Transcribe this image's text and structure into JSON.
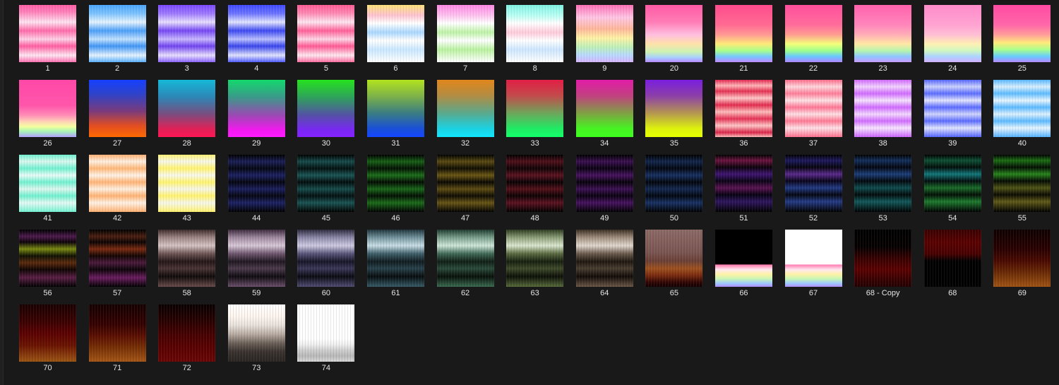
{
  "window": {
    "items": [
      {
        "label": "1",
        "bg": "linear-gradient(180deg,#ff5fa5 0%,#ff7fb8 12%,#ffe3f0 30%,#ff6aa9 45%,#ffd0e6 60%,#ff5da0 72%,#ffe6f2 88%,#ff6fb0 100%)",
        "tex": "wave"
      },
      {
        "label": "2",
        "bg": "linear-gradient(180deg,#4aa7ff 0%,#7cc3ff 15%,#e5f3ff 30%,#4a9ef8 45%,#bfe0ff 60%,#3f95f5 72%,#e3f2ff 88%,#57afff 100%)",
        "tex": "wave"
      },
      {
        "label": "3",
        "bg": "linear-gradient(180deg,#7a48ff 0%,#9d78ff 15%,#e7deff 30%,#7446f4 45%,#c7b6ff 60%,#6f42ef 72%,#e6ddff 88%,#8a60ff 100%)",
        "tex": "wave"
      },
      {
        "label": "4",
        "bg": "linear-gradient(180deg,#3f49ff 0%,#6a73ff 15%,#e2e5ff 30%,#3a47f0 45%,#b9bfff 60%,#3643ea 72%,#e0e3ff 88%,#4d59ff 100%)",
        "tex": "wave"
      },
      {
        "label": "5",
        "bg": "linear-gradient(180deg,#ff5a95 0%,#ff86b2 14%,#ffe5ef 30%,#ff5f98 45%,#ffd4e5 60%,#ff5a93 72%,#ffe6ef 88%,#ff6b9f 100%)",
        "tex": "wave"
      },
      {
        "label": "6",
        "bg": "linear-gradient(180deg,#ffe27a 0%,#ffc2cf 18%,#ffffff 32%,#a9d7ff 48%,#ffffff 62%,#c9e7ff 78%,#ffffff 100%)",
        "tex": "wave"
      },
      {
        "label": "7",
        "bg": "linear-gradient(180deg,#ff88e4 0%,#ffc1ef 18%,#ffffff 32%,#bdf3a6 48%,#ffffff 62%,#b9f29f 78%,#ffffff 100%)",
        "tex": "wave"
      },
      {
        "label": "8",
        "bg": "linear-gradient(180deg,#7ef2e2 0%,#b8fff4 18%,#ffffff 32%,#ffcadb 48%,#ffffff 62%,#cde6ff 78%,#ffffff 100%)",
        "tex": "wave"
      },
      {
        "label": "9",
        "bg": "linear-gradient(180deg,#ff6fb6 0%,#ffc6e5 22%,#ffb79a 42%,#fff2a5 58%,#bdf0b9 74%,#b8d8ff 88%,#d6b4ff 100%)",
        "tex": "wave"
      },
      {
        "label": "20",
        "bg": "linear-gradient(180deg,#ff5aa5 0%,#ff7db6 30%,#ffbfe0 52%,#ffe1a9 68%,#ccf2b3 82%,#a8cfff 92%,#b888ff 100%)",
        "tex": ""
      },
      {
        "label": "21",
        "bg": "linear-gradient(180deg,#ff4b8d 0%,#ff6b93 35%,#ff9a95 52%,#ffe978 68%,#a8ff8a 80%,#75c8ff 90%,#c089ff 100%)",
        "tex": ""
      },
      {
        "label": "22",
        "bg": "linear-gradient(180deg,#ff4f9c 0%,#ff6d9b 35%,#ff9e92 52%,#f4ff7a 68%,#9dff8c 80%,#68c7ff 90%,#b286ff 100%)",
        "tex": ""
      },
      {
        "label": "23",
        "bg": "linear-gradient(180deg,#ff62ac 0%,#ff86bb 35%,#ffaeb8 52%,#ffe7a4 68%,#b5f5ad 80%,#8fc6ff 90%,#c99cff 100%)",
        "tex": ""
      },
      {
        "label": "24",
        "bg": "linear-gradient(180deg,#ff8bca 0%,#ffa4d2 35%,#ffbfd4 52%,#fff0b3 68%,#cff7c0 80%,#acd4ff 90%,#d2b0ff 100%)",
        "tex": ""
      },
      {
        "label": "25",
        "bg": "linear-gradient(180deg,#ff4aa2 0%,#ff67a9 35%,#ff9d9a 52%,#ffe97b 66%,#a9ff8b 78%,#68cbff 90%,#b689ff 100%)",
        "tex": ""
      },
      {
        "label": "26",
        "bg": "linear-gradient(180deg,#ff48a8 0%,#ff56aa 45%,#ff8db7 62%,#ffd8b5 74%,#f3ff9f 82%,#a7f5b6 90%,#b4a0ff 100%)",
        "tex": ""
      },
      {
        "label": "27",
        "bg": "linear-gradient(180deg,#1640ff 0%,#2f43c8 25%,#7b3b7a 55%,#e14e22 80%,#ff6a00 100%)",
        "tex": ""
      },
      {
        "label": "28",
        "bg": "linear-gradient(180deg,#16b9d8 0%,#2c86b6 30%,#7a4d7f 60%,#de2257 85%,#ff1555 100%)",
        "tex": ""
      },
      {
        "label": "29",
        "bg": "linear-gradient(180deg,#13d86c 0%,#3a9a89 30%,#9b49b3 62%,#f319ef 88%,#ff1cff 100%)",
        "tex": ""
      },
      {
        "label": "30",
        "bg": "linear-gradient(180deg,#26e21e 0%,#2ea35a 30%,#5550a6 62%,#7a27f5 88%,#8622ff 100%)",
        "tex": ""
      },
      {
        "label": "31",
        "bg": "linear-gradient(180deg,#b2e31e 0%,#7fb348 28%,#3b7d82 58%,#1a50d6 85%,#1446ff 100%)",
        "tex": ""
      },
      {
        "label": "32",
        "bg": "linear-gradient(180deg,#e1871b 0%,#b18c44 28%,#5aa98d 58%,#1cd1e1 85%,#12e7ff 100%)",
        "tex": ""
      },
      {
        "label": "33",
        "bg": "linear-gradient(180deg,#e21f46 0%,#c24b4b 28%,#6fa55b 58%,#20ea63 85%,#14ff6a 100%)",
        "tex": ""
      },
      {
        "label": "34",
        "bg": "linear-gradient(180deg,#e21ca8 0%,#c0417f 28%,#80a044 58%,#47f222 85%,#3cff1f 100%)",
        "tex": ""
      },
      {
        "label": "35",
        "bg": "linear-gradient(180deg,#7a1fe0 0%,#8c3fa8 28%,#b49650 58%,#dcf10e 85%,#e6ff00 100%)",
        "tex": ""
      },
      {
        "label": "36",
        "bg": "linear-gradient(180deg,#e2254e 0%,#ffb4b7 10%,#e43152 20%,#ffc6c7 32%,#e12a4d 44%,#ffbcbc 56%,#e43254 68%,#ffc5c5 80%,#d92448 92%,#ffbdbd 100%)",
        "tex": "wave"
      },
      {
        "label": "37",
        "bg": "linear-gradient(180deg,#ff6a8a 0%,#ffd7dd 12%,#ff7d98 24%,#ffe3e6 36%,#ff7594 48%,#ffdfe4 60%,#ff7893 72%,#ffe0e6 84%,#ff6f8c 100%)",
        "tex": "wave"
      },
      {
        "label": "38",
        "bg": "linear-gradient(180deg,#d168ff 0%,#f2d2ff 12%,#d06bff 24%,#f6e3ff 36%,#cf69ff 48%,#f2d7ff 60%,#d06cff 72%,#f6e3ff 84%,#cc63ff 100%)",
        "tex": "wave"
      },
      {
        "label": "39",
        "bg": "linear-gradient(180deg,#5566ff 0%,#cbd1ff 12%,#5a6bff 24%,#e3e6ff 36%,#5969ff 48%,#cfd4ff 60%,#5a6aff 72%,#e0e4ff 84%,#5262ff 100%)",
        "tex": "wave"
      },
      {
        "label": "40",
        "bg": "linear-gradient(180deg,#56b7ff 0%,#d7efff 12%,#5cbbff 24%,#e7f6ff 36%,#5ab9ff 48%,#dcf0ff 60%,#5bb9ff 72%,#e5f5ff 84%,#53b2ff 100%)",
        "tex": "wave"
      },
      {
        "label": "41",
        "bg": "linear-gradient(180deg,#6ff1d0 0%,#d9f8ef 12%,#6ff0cf 24%,#e7fbf6 36%,#6ff0cf 48%,#dcf7ef 60%,#6ef0ce 72%,#e4f9f4 84%,#73f2d2 100%)",
        "tex": "wave"
      },
      {
        "label": "42",
        "bg": "linear-gradient(180deg,#ffb071 0%,#fff0e1 12%,#ffb677 24%,#fff2e6 36%,#ffb374 48%,#ffefdf 60%,#ffb272 72%,#fff1e4 84%,#ffb06f 100%)",
        "tex": "wave"
      },
      {
        "label": "43",
        "bg": "linear-gradient(180deg,#fff271 0%,#f7f7e8 12%,#fff36e 24%,#f8f8ec 36%,#fff36d 48%,#f6f6e7 60%,#fff26d 72%,#f7f7ea 84%,#fff16c 100%)",
        "tex": "wave"
      },
      {
        "label": "44",
        "bg": "linear-gradient(180deg,#000000 0%,#1a1f55 12%,#050612 24%,#1b2160 36%,#04050f 48%,#1a1f5b 60%,#050611 72%,#1c2262 84%,#000000 100%)",
        "tex": "dark"
      },
      {
        "label": "45",
        "bg": "linear-gradient(180deg,#000000 0%,#174a4a 12%,#031010 24%,#1b5555 36%,#020c0c 48%,#174b4b 60%,#031010 72%,#1a5353 84%,#000000 100%)",
        "tex": "dark"
      },
      {
        "label": "46",
        "bg": "linear-gradient(180deg,#000000 0%,#175f16 12%,#031103 24%,#1c6e1a 36%,#020b02 48%,#186518 60%,#031003 72%,#1b6b19 84%,#000000 100%)",
        "tex": "dark"
      },
      {
        "label": "47",
        "bg": "linear-gradient(180deg,#000000 0%,#5a4a12 12%,#0f0c02 24%,#6a5714 36%,#090701 48%,#5d4c12 60%,#0e0b02 72%,#675515 84%,#000000 100%)",
        "tex": "dark"
      },
      {
        "label": "48",
        "bg": "linear-gradient(180deg,#000000 0%,#4f0f1a 12%,#0f0205 24%,#5c1220 36%,#090103 48%,#531019 60%,#0e0204 72%,#5b1220 84%,#000000 100%)",
        "tex": "dark"
      },
      {
        "label": "49",
        "bg": "linear-gradient(180deg,#000000 0%,#3a0f4f 12%,#0a0212 24%,#46125e 36%,#07020b 48%,#3c1052 60%,#0a0211 72%,#46125f 84%,#000000 100%)",
        "tex": "dark"
      },
      {
        "label": "50",
        "bg": "linear-gradient(180deg,#000000 0%,#12254a 12%,#020710 24%,#173061 36%,#02060c 48%,#13284f 60%,#020710 72%,#183163 84%,#000000 100%)",
        "tex": "dark"
      },
      {
        "label": "51",
        "bg": "linear-gradient(180deg,#000000 0%,#6b1440 10%,#0b020a 22%,#3f1473 34%,#0a0314 46%,#5a1252 58%,#070212 70%,#2f165e 82%,#000000 100%)",
        "tex": "dark"
      },
      {
        "label": "52",
        "bg": "linear-gradient(180deg,#000000 0%,#1d1a5c 10%,#05040e 22%,#5a2a8c 34%,#08041a 46%,#223a84 58%,#040611 70%,#243b85 82%,#000000 100%)",
        "tex": "dark"
      },
      {
        "label": "53",
        "bg": "linear-gradient(180deg,#000000 0%,#132f5a 10%,#030610 22%,#1b3e78 34%,#02080e 46%,#0f4b4f 58%,#020b0b 70%,#12585a 82%,#000000 100%)",
        "tex": "dark"
      },
      {
        "label": "54",
        "bg": "linear-gradient(180deg,#000000 0%,#0e4f35 10%,#020e09 22%,#12777a 34%,#020d0e 46%,#1a6b2a 58%,#030f05 70%,#1e7a2e 82%,#000000 100%)",
        "tex": "dark"
      },
      {
        "label": "55",
        "bg": "linear-gradient(180deg,#000000 0%,#1c6e14 10%,#030f02 22%,#27841b 34%,#040b02 46%,#4e5415 58%,#0b0b02 70%,#5f5a17 82%,#000000 100%)",
        "tex": "dark"
      },
      {
        "label": "56",
        "bg": "linear-gradient(180deg,#000000 0%,#4b1a4b 12%,#0b0208 22%,#7a8a12 34%,#0f1002 46%,#5a2a0c 58%,#0e0402 70%,#5a1f45 84%,#000000 100%)",
        "tex": "dark"
      },
      {
        "label": "57",
        "bg": "linear-gradient(180deg,#000000 0%,#4b1e10 12%,#0c0403 22%,#7a2a10 34%,#120502 46%,#4a1a3b 58%,#0c0308 70%,#6a1d5e 84%,#000000 100%)",
        "tex": "dark"
      },
      {
        "label": "58",
        "bg": "linear-gradient(180deg,#3c2a2a 0%,#9f8686 14%,#d6c3c3 28%,#6e5454 42%,#231616 56%,#4a3333 68%,#0f0a0a 82%,#6a4a4a 100%)",
        "tex": "dark"
      },
      {
        "label": "59",
        "bg": "linear-gradient(180deg,#3c2a3c 0%,#a08aa0 14%,#d8c9d8 28%,#6e566e 42%,#1f1720 56%,#4b3a4b 68%,#0f0b10 82%,#6a4f6a 100%)",
        "tex": "dark"
      },
      {
        "label": "60",
        "bg": "linear-gradient(180deg,#2d2a3f 0%,#8c88a8 14%,#cfcbe3 28%,#58557a 42%,#161526 56%,#3b3858 68%,#0a0a12 82%,#4f4c72 100%)",
        "tex": "dark"
      },
      {
        "label": "61",
        "bg": "linear-gradient(180deg,#1e343c 0%,#74939c 14%,#c9dfe6 28%,#3f5f6a 42%,#0f1b1f 56%,#27414a 68%,#070d0f 82%,#365a66 100%)",
        "tex": "dark"
      },
      {
        "label": "62",
        "bg": "linear-gradient(180deg,#1e3a2e 0%,#7aa08c 14%,#cfe7d9 28%,#406a56 42%,#0f1e16 56%,#2a4a3a 68%,#071009 82%,#3a6a50 100%)",
        "tex": "dark"
      },
      {
        "label": "63",
        "bg": "linear-gradient(180deg,#2c3a1e 0%,#8ea07a 14%,#dbe7cf 28%,#5a6a40 42%,#161e0f 56%,#3f4a2a 68%,#0c1007 82%,#56693a 100%)",
        "tex": "dark"
      },
      {
        "label": "64",
        "bg": "linear-gradient(180deg,#3a2e22 0%,#a08f7f 14%,#e2d8cf 28%,#6a5a4c 42%,#1e1710 56%,#4a3d30 68%,#100b07 82%,#6a5646 100%)",
        "tex": "dark"
      },
      {
        "label": "65",
        "bg": "linear-gradient(180deg,#8d6a66 0%,#7a5652 40%,#6b4035 55%,#a0521f 68%,#7a2a0f 80%,#300504 92%,#120000 100%)",
        "tex": "dark"
      },
      {
        "label": "66",
        "bg": "linear-gradient(180deg,#000000 0%,#000000 60%,#ff7fb0 62%,#ffe9f0 70%,#fff2a6 78%,#c9f6b5 86%,#9fc8ff 94%,#b08cff 100%)",
        "tex": ""
      },
      {
        "label": "67",
        "bg": "linear-gradient(180deg,#ffffff 0%,#ffffff 60%,#ff84b6 62%,#ffe7f0 70%,#fff1a7 78%,#c7f7b3 86%,#9fc8ff 94%,#b38dff 100%)",
        "tex": ""
      },
      {
        "label": "68 - Copy",
        "bg": "linear-gradient(180deg,#000000 0%,#050000 30%,#3a0000 52%,#5a0000 70%,#3a0000 86%,#220000 100%)",
        "tex": "dark"
      },
      {
        "label": "68",
        "bg": "linear-gradient(180deg,#3a0000 0%,#5a0000 22%,#4a0000 42%,#000000 55%,#000000 100%)",
        "tex": "dark"
      },
      {
        "label": "69",
        "bg": "linear-gradient(180deg,#0f0000 0%,#2a0000 35%,#4a0a00 55%,#6a2a05 75%,#a05312 100%)",
        "tex": "dark"
      },
      {
        "label": "70",
        "bg": "linear-gradient(180deg,#1a0000 0%,#3a0000 30%,#5a0000 50%,#6a1400 72%,#9c5512 100%)",
        "tex": "dark"
      },
      {
        "label": "71",
        "bg": "linear-gradient(180deg,#150000 0%,#350000 35%,#5a0f00 55%,#7a3306 78%,#a65616 100%)",
        "tex": "dark"
      },
      {
        "label": "72",
        "bg": "linear-gradient(180deg,#0a0000 0%,#2a0000 30%,#4a0000 55%,#5a0000 75%,#6a0505 100%)",
        "tex": "dark"
      },
      {
        "label": "73",
        "bg": "linear-gradient(180deg,#ffffff 0%,#fff6f0 20%,#e9e3dd 36%,#b8aca2 52%,#6a5f57 68%,#3a332f 82%,#2a2522 100%)",
        "tex": "dark"
      },
      {
        "label": "74",
        "bg": "linear-gradient(180deg,#ffffff 0%,#ffffff 60%,#f0f0f0 70%,#cfcfcf 80%,#b9b9b9 90%,#d8d8d8 100%)",
        "tex": "dark"
      }
    ]
  }
}
